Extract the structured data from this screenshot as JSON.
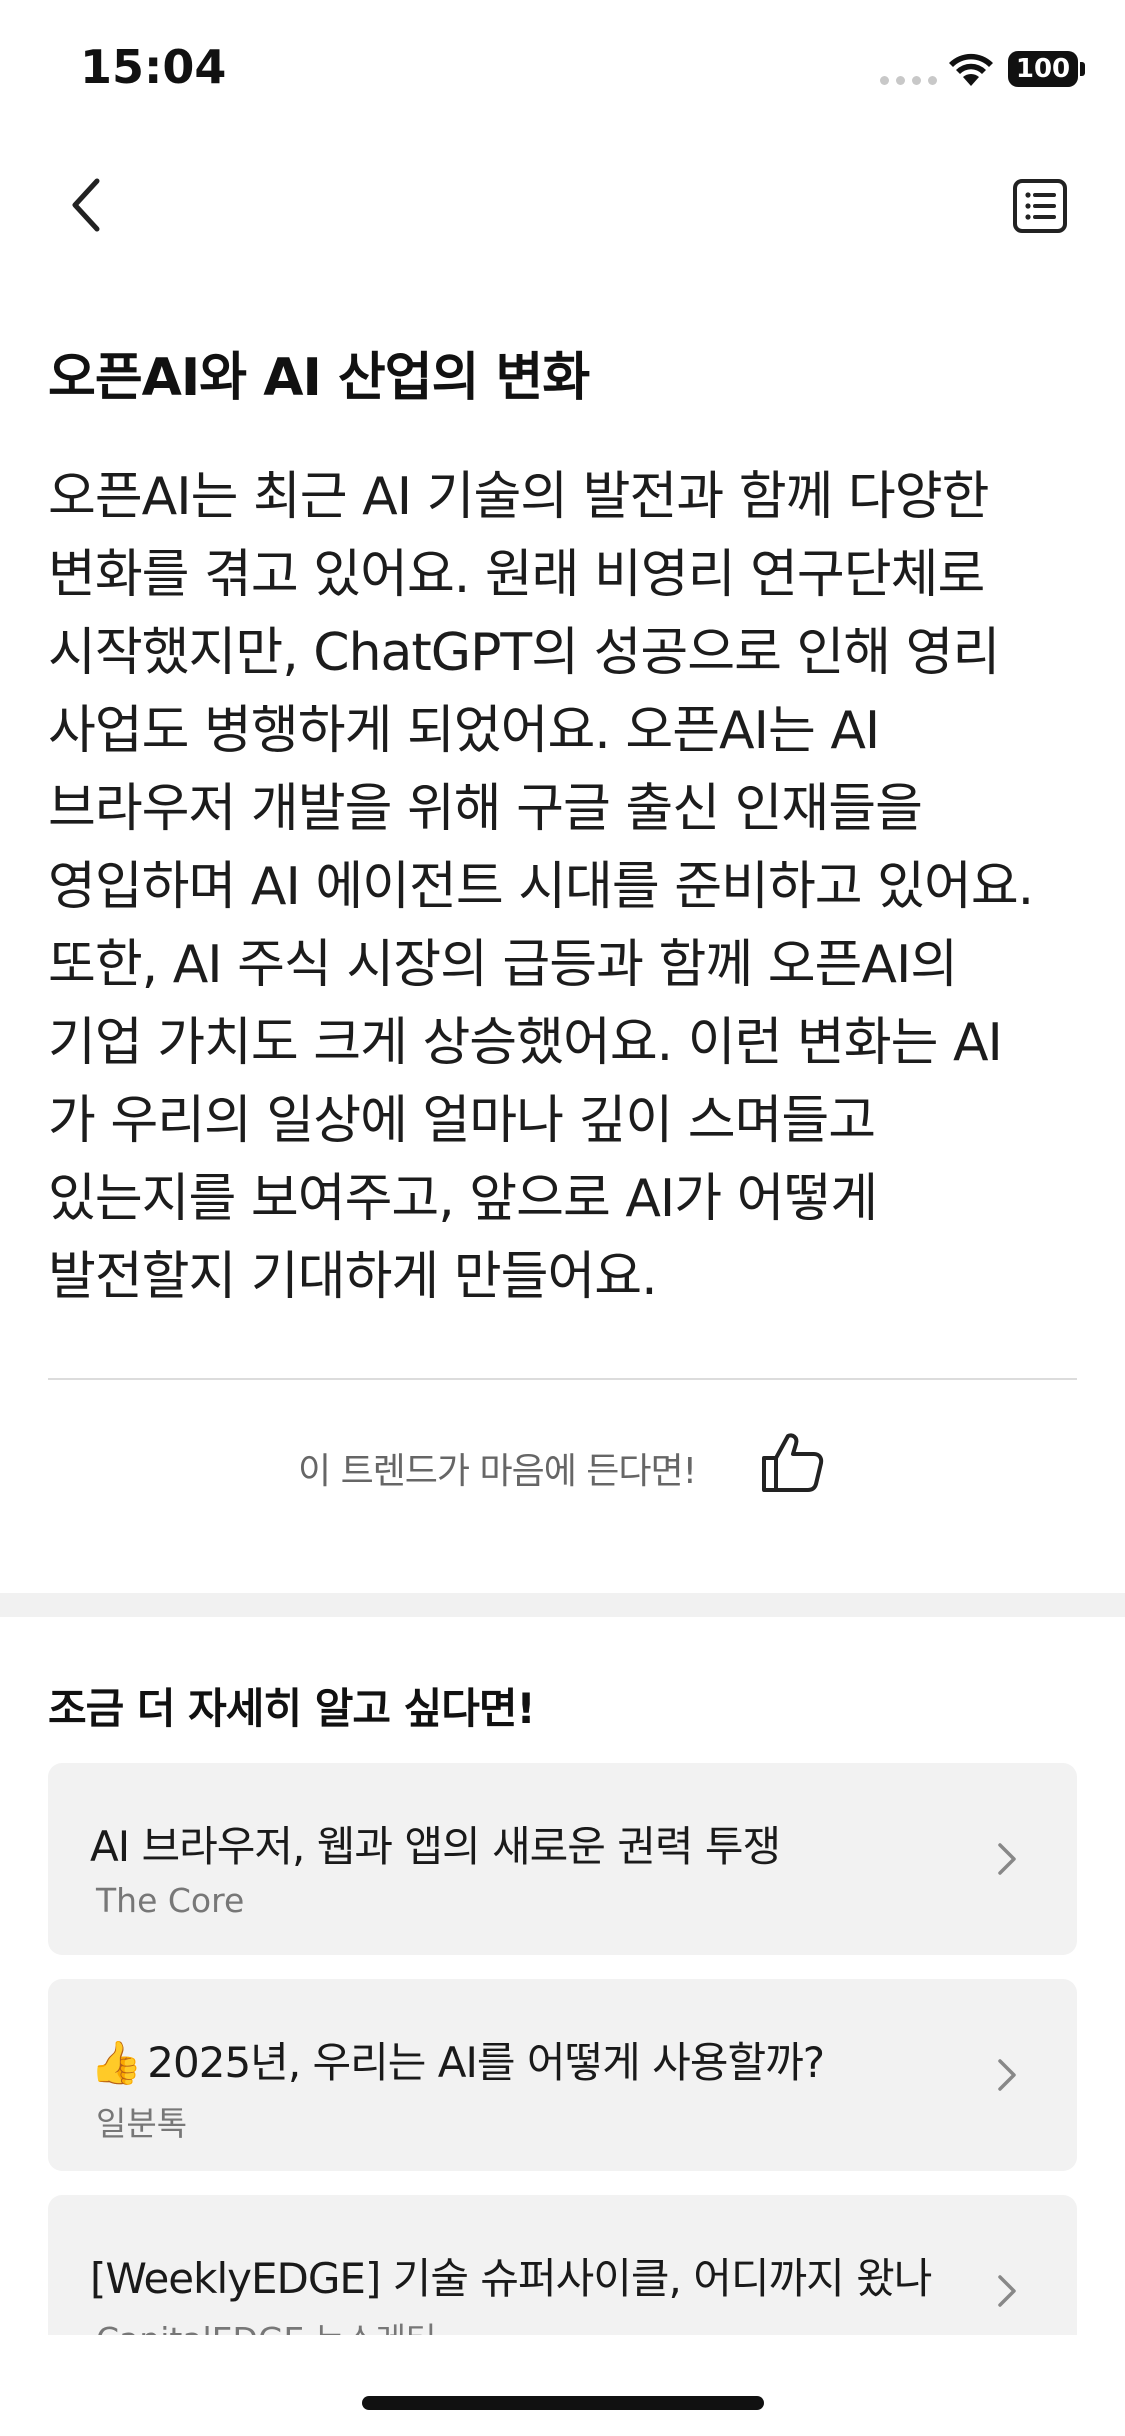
{
  "status": {
    "time": "15:04",
    "battery": "100"
  },
  "nav": {
    "back_icon": "chevron-left-icon",
    "list_icon": "list-icon"
  },
  "article": {
    "title": "오픈AI와 AI 산업의 변화",
    "lines": [
      "오픈AI는 최근 AI 기술의 발전과 함께 다양한",
      "변화를 겪고 있어요. 원래 비영리 연구단체로",
      "시작했지만, ChatGPT의 성공으로 인해 영리",
      "사업도 병행하게 되었어요. 오픈AI는 AI",
      "브라우저 개발을 위해 구글 출신 인재들을",
      "영입하며 AI 에이전트 시대를 준비하고 있어요.",
      "또한, AI 주식 시장의 급등과 함께 오픈AI의",
      "기업 가치도 크게 상승했어요. 이런 변화는 AI",
      "가 우리의 일상에 얼마나 깊이 스며들고",
      "있는지를 보여주고, 앞으로 AI가 어떻게",
      "발전할지 기대하게 만들어요."
    ]
  },
  "like": {
    "text": "이 트렌드가 마음에 든다면!",
    "icon": "thumbs-up-icon"
  },
  "more": {
    "title": "조금 더 자세히 알고 싶다면!",
    "items": [
      {
        "title": "AI 브라우저, 웹과 앱의 새로운 권력 투쟁",
        "source": "The Core"
      },
      {
        "emoji": "👍",
        "title": "2025년, 우리는 AI를 어떻게 사용할까?",
        "source": "일분톡"
      },
      {
        "title": "[WeeklyEDGE] 기술 슈퍼사이클, 어디까지 왔나",
        "source": "CapitalEDGE 뉴스레터"
      }
    ]
  }
}
